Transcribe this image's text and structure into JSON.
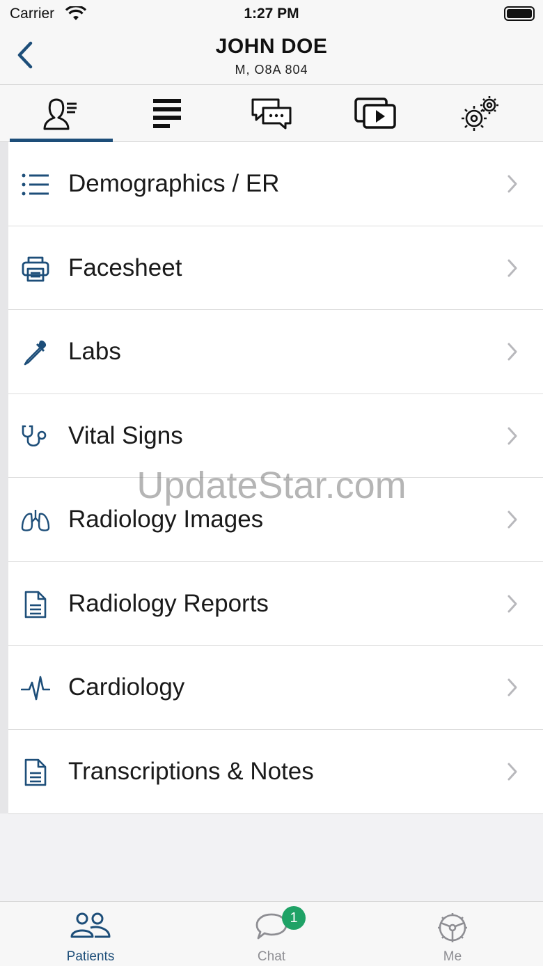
{
  "status_bar": {
    "carrier": "Carrier",
    "time": "1:27 PM"
  },
  "header": {
    "patient_name": "JOHN DOE",
    "patient_info": "M, O8A 804"
  },
  "top_tabs": [
    {
      "icon": "patient-profile-icon",
      "active": true
    },
    {
      "icon": "list-lines-icon",
      "active": false
    },
    {
      "icon": "chat-bubbles-icon",
      "active": false
    },
    {
      "icon": "media-play-icon",
      "active": false
    },
    {
      "icon": "gears-icon",
      "active": false
    }
  ],
  "menu": {
    "items": [
      {
        "label": "Demographics / ER",
        "icon": "list-icon"
      },
      {
        "label": "Facesheet",
        "icon": "printer-icon"
      },
      {
        "label": "Labs",
        "icon": "dropper-icon"
      },
      {
        "label": "Vital Signs",
        "icon": "stethoscope-icon"
      },
      {
        "label": "Radiology Images",
        "icon": "lungs-icon"
      },
      {
        "label": "Radiology Reports",
        "icon": "document-icon"
      },
      {
        "label": "Cardiology",
        "icon": "heartbeat-icon"
      },
      {
        "label": "Transcriptions & Notes",
        "icon": "document-icon"
      }
    ]
  },
  "watermark": "UpdateStar.com",
  "bottom_tabs": {
    "patients": {
      "label": "Patients",
      "active": true
    },
    "chat": {
      "label": "Chat",
      "badge": "1"
    },
    "me": {
      "label": "Me"
    }
  },
  "colors": {
    "accent": "#1d4e79",
    "badge": "#1fa266",
    "inactive": "#8e8e93"
  }
}
